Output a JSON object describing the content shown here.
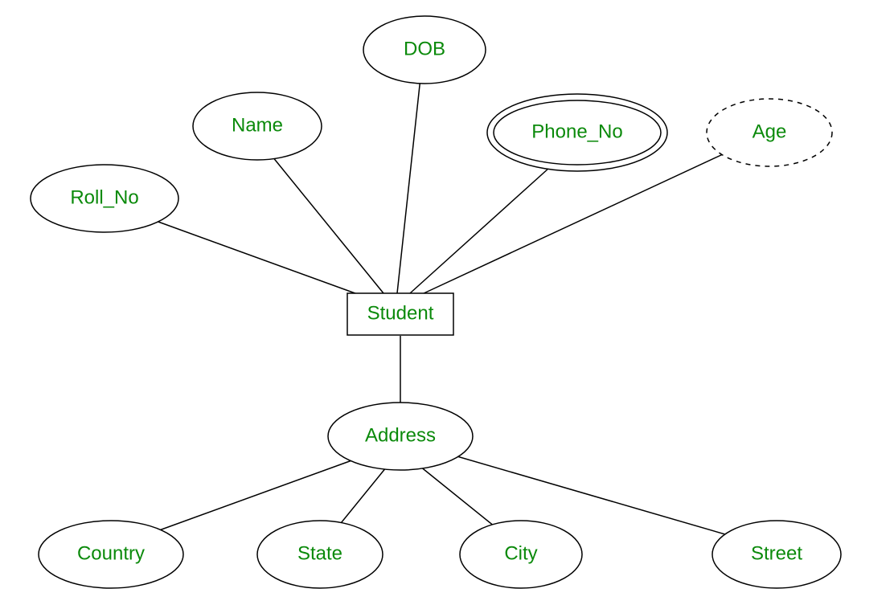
{
  "entity": {
    "label": "Student"
  },
  "attributes": {
    "roll_no": {
      "label": "Roll_No",
      "variant": "simple"
    },
    "name": {
      "label": "Name",
      "variant": "simple"
    },
    "dob": {
      "label": "DOB",
      "variant": "simple"
    },
    "phone_no": {
      "label": "Phone_No",
      "variant": "multivalued"
    },
    "age": {
      "label": "Age",
      "variant": "derived"
    },
    "address": {
      "label": "Address",
      "variant": "composite"
    }
  },
  "address_children": {
    "country": {
      "label": "Country"
    },
    "state": {
      "label": "State"
    },
    "city": {
      "label": "City"
    },
    "street": {
      "label": "Street"
    }
  },
  "colors": {
    "text": "#0b8a0b",
    "stroke": "#000000",
    "background": "#ffffff"
  }
}
